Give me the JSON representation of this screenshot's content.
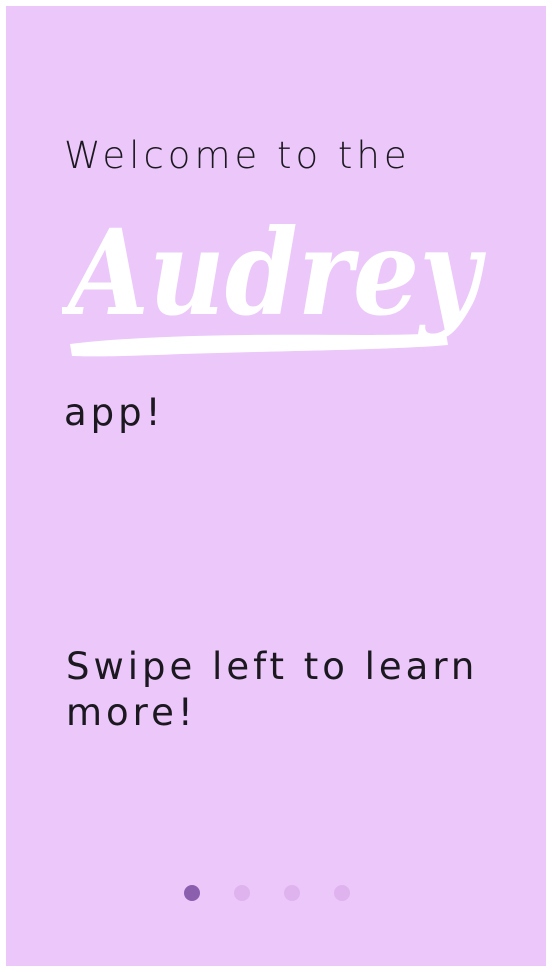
{
  "onboarding": {
    "welcome_text": "Welcome to the",
    "brand_name": "Audrey",
    "app_text": "app!",
    "swipe_hint": "Swipe left to learn more!"
  },
  "pager": {
    "page_count": 4,
    "current_page": 1
  },
  "colors": {
    "background": "#ebc7fa",
    "text": "#1c1820",
    "brand": "#ffffff",
    "dot_active": "#8b5fae",
    "dot_inactive": "#dfb3ee"
  }
}
